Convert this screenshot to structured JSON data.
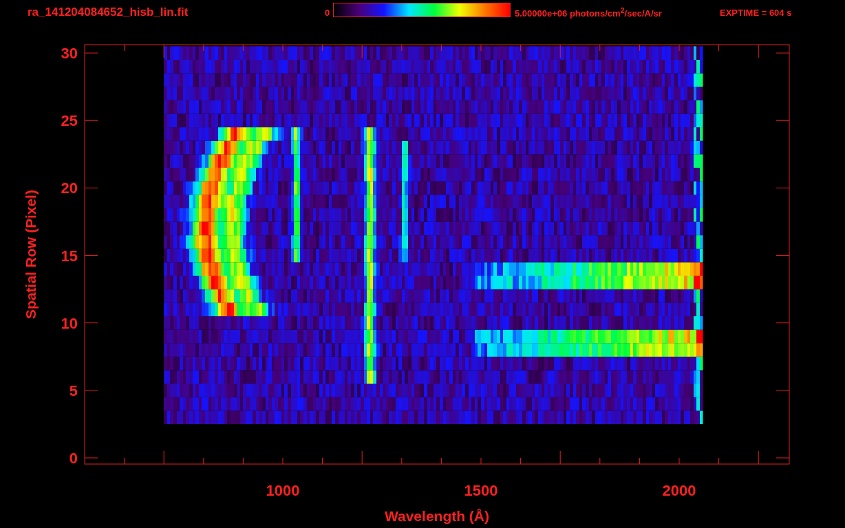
{
  "header": {
    "filename": "ra_141204084652_hisb_lin.fit",
    "colorbar": {
      "min_label": "0",
      "max_label": "5.00000e+06 photons/cm$^{2}$/sec/A/sr"
    },
    "exposure": "EXPTIME = 604 s"
  },
  "plot": {
    "xlabel": "Wavelength (Å)",
    "ylabel": "Spatial Row (Pixel)",
    "xticks": [
      "1000",
      "1500",
      "2000"
    ],
    "yticks": [
      "30",
      "25",
      "20",
      "15",
      "10",
      "5",
      "0"
    ]
  }
}
